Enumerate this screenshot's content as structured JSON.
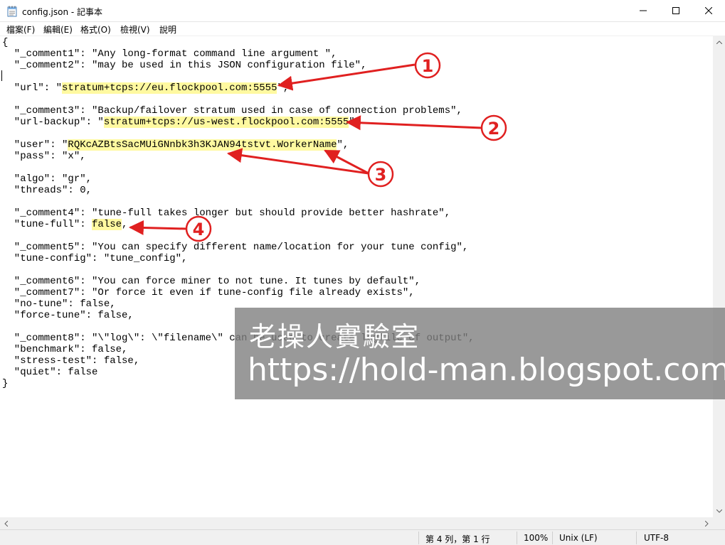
{
  "window": {
    "title": "config.json - 記事本",
    "icon": "notepad-icon"
  },
  "menu": {
    "items": [
      "檔案(F)",
      "編輯(E)",
      "格式(O)",
      "檢視(V)",
      "說明"
    ]
  },
  "editor": {
    "lines": [
      {
        "text": "{"
      },
      {
        "text": "  \"_comment1\": \"Any long-format command line argument \","
      },
      {
        "text": "  \"_comment2\": \"may be used in this JSON configuration file\","
      },
      {
        "text": ""
      },
      {
        "pre": "  \"url\": \"",
        "hl": "stratum+tcps://eu.flockpool.com:5555",
        "post": "\","
      },
      {
        "text": ""
      },
      {
        "text": "  \"_comment3\": \"Backup/failover stratum used in case of connection problems\","
      },
      {
        "pre": "  \"url-backup\": \"",
        "hl": "stratum+tcps://us-west.flockpool.com:5555",
        "post": "\","
      },
      {
        "text": ""
      },
      {
        "pre": "  \"user\": \"",
        "hl": "RQKcAZBtsSacMUiGNnbk3h3KJAN94tstvt.WorkerName",
        "post": "\","
      },
      {
        "text": "  \"pass\": \"x\","
      },
      {
        "text": ""
      },
      {
        "text": "  \"algo\": \"gr\","
      },
      {
        "text": "  \"threads\": 0,"
      },
      {
        "text": ""
      },
      {
        "text": "  \"_comment4\": \"tune-full takes longer but should provide better hashrate\","
      },
      {
        "pre": "  \"tune-full\": ",
        "hl": "false",
        "post": ","
      },
      {
        "text": ""
      },
      {
        "text": "  \"_comment5\": \"You can specify different name/location for your tune config\","
      },
      {
        "text": "  \"tune-config\": \"tune_config\","
      },
      {
        "text": ""
      },
      {
        "text": "  \"_comment6\": \"You can force miner to not tune. It tunes by default\","
      },
      {
        "text": "  \"_comment7\": \"Or force it even if tune-config file already exists\","
      },
      {
        "text": "  \"no-tune\": false,"
      },
      {
        "text": "  \"force-tune\": false,"
      },
      {
        "text": ""
      },
      {
        "text": "  \"_comment8\": \"\\\"log\\\": \\\"filename\\\" can be used to create logfile of output\","
      },
      {
        "text": "  \"benchmark\": false,"
      },
      {
        "text": "  \"stress-test\": false,"
      },
      {
        "text": "  \"quiet\": false"
      },
      {
        "text": "}"
      }
    ],
    "highlight_color": "#fff9a0"
  },
  "statusbar": {
    "position": "第 4 列，第 1 行",
    "zoom": "100%",
    "line_ending": "Unix (LF)",
    "encoding": "UTF-8"
  },
  "watermark": {
    "line1": "老操人實驗室",
    "line2": "https://hold-man.blogspot.com"
  },
  "annotations": {
    "color": "#e02020",
    "labels": [
      "1",
      "2",
      "3",
      "4"
    ]
  }
}
